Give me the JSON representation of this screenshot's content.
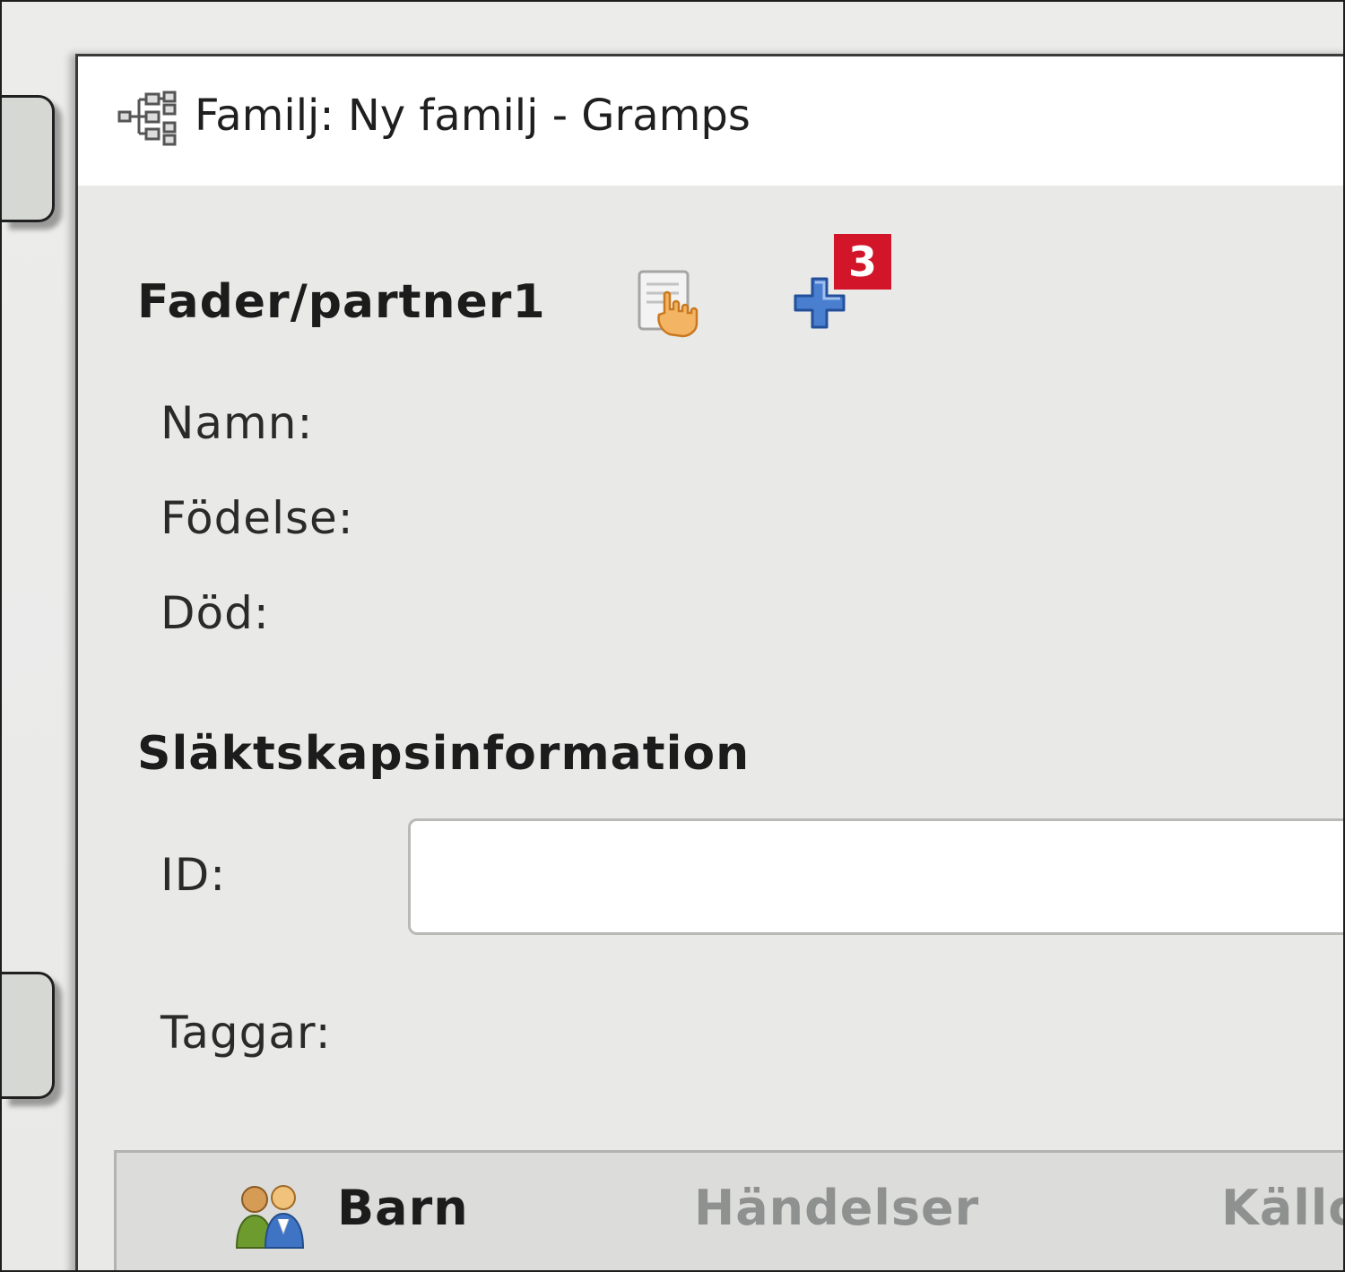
{
  "window": {
    "title": "Familj: Ny familj - Gramps"
  },
  "father_section": {
    "title": "Fader/partner1",
    "select_icon": "select-existing-person-icon",
    "add_icon": "add-person-icon",
    "badge": "3",
    "fields": {
      "name_label": "Namn:",
      "birth_label": "Födelse:",
      "death_label": "Död:"
    }
  },
  "relationship_section": {
    "title": "Släktskapsinformation",
    "id_label": "ID:",
    "id_value": "",
    "tags_label": "Taggar:"
  },
  "tabs": [
    {
      "label": "Barn",
      "icon": "children-icon",
      "active": true
    },
    {
      "label": "Händelser",
      "active": false
    },
    {
      "label": "Källo",
      "active": false
    }
  ],
  "colors": {
    "badge": "#d3152a",
    "add_icon": "#2f63b5"
  }
}
